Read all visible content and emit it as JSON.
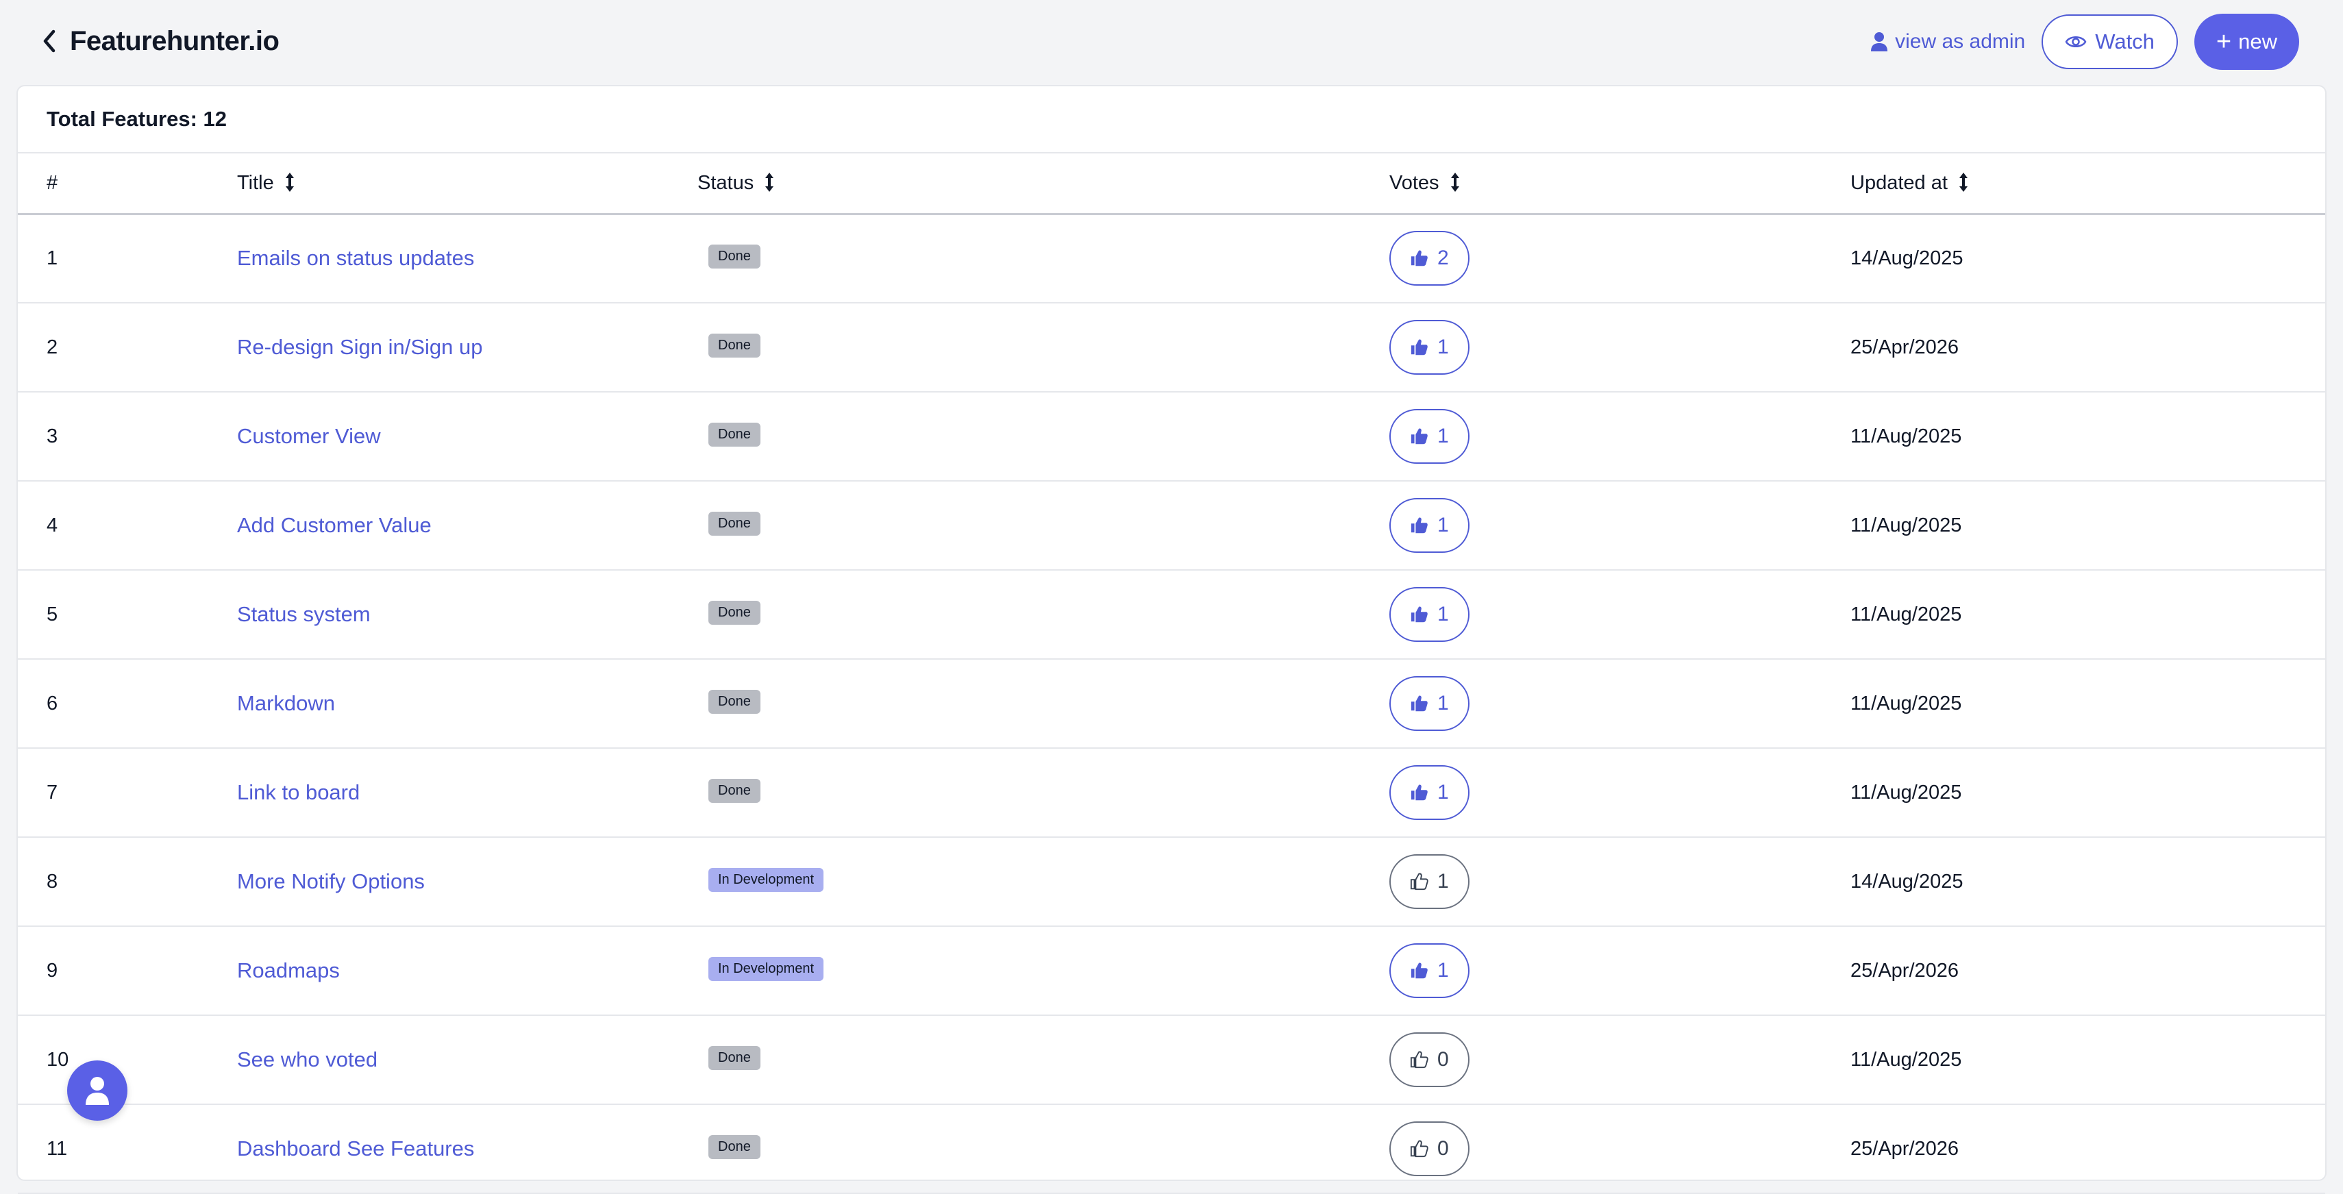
{
  "header": {
    "brand": "Featurehunter.io",
    "admin_label": "view as admin",
    "watch_label": "Watch",
    "new_label": "new"
  },
  "colors": {
    "accent": "#5a60e6",
    "link": "#4f5bd5",
    "badge_done": "#b8bbc2",
    "badge_dev": "#a8aef0"
  },
  "summary": {
    "total_label": "Total Features: 12"
  },
  "columns": {
    "num": "#",
    "title": "Title",
    "status": "Status",
    "votes": "Votes",
    "updated": "Updated at"
  },
  "rows": [
    {
      "num": "1",
      "title": "Emails on status updates",
      "status": "Done",
      "votes": "2",
      "voted": true,
      "updated": "14/Aug/2025"
    },
    {
      "num": "2",
      "title": "Re-design Sign in/Sign up",
      "status": "Done",
      "votes": "1",
      "voted": true,
      "updated": "25/Apr/2026"
    },
    {
      "num": "3",
      "title": "Customer View",
      "status": "Done",
      "votes": "1",
      "voted": true,
      "updated": "11/Aug/2025"
    },
    {
      "num": "4",
      "title": "Add Customer Value",
      "status": "Done",
      "votes": "1",
      "voted": true,
      "updated": "11/Aug/2025"
    },
    {
      "num": "5",
      "title": "Status system",
      "status": "Done",
      "votes": "1",
      "voted": true,
      "updated": "11/Aug/2025"
    },
    {
      "num": "6",
      "title": "Markdown",
      "status": "Done",
      "votes": "1",
      "voted": true,
      "updated": "11/Aug/2025"
    },
    {
      "num": "7",
      "title": "Link to board",
      "status": "Done",
      "votes": "1",
      "voted": true,
      "updated": "11/Aug/2025"
    },
    {
      "num": "8",
      "title": "More Notify Options",
      "status": "In Development",
      "votes": "1",
      "voted": false,
      "updated": "14/Aug/2025"
    },
    {
      "num": "9",
      "title": "Roadmaps",
      "status": "In Development",
      "votes": "1",
      "voted": true,
      "updated": "25/Apr/2026"
    },
    {
      "num": "10",
      "title": "See who voted",
      "status": "Done",
      "votes": "0",
      "voted": false,
      "updated": "11/Aug/2025"
    },
    {
      "num": "11",
      "title": "Dashboard See Features",
      "status": "Done",
      "votes": "0",
      "voted": false,
      "updated": "25/Apr/2026"
    }
  ],
  "icons": {
    "back": "chevron-left-icon",
    "admin": "user-icon",
    "watch": "eye-icon",
    "new": "plus-icon",
    "vote": "thumbs-up-icon",
    "fab": "user-icon"
  }
}
